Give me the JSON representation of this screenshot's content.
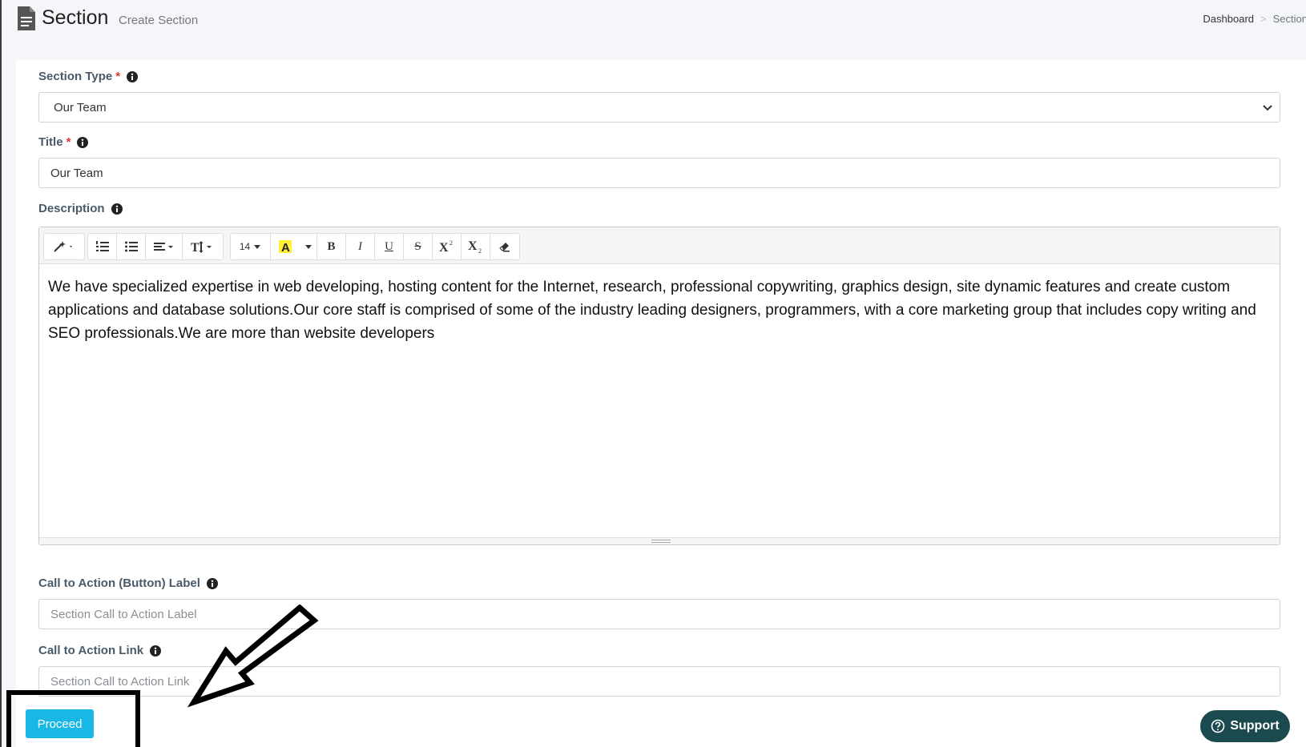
{
  "header": {
    "title": "Section",
    "subtitle": "Create Section",
    "breadcrumb": [
      {
        "label": "Dashboard"
      },
      {
        "label": "Section"
      }
    ],
    "breadcrumb_separator": ">"
  },
  "form": {
    "section_type": {
      "label": "Section Type",
      "required_mark": "*",
      "value": "Our Team"
    },
    "title": {
      "label": "Title",
      "required_mark": "*",
      "value": "Our Team"
    },
    "description": {
      "label": "Description",
      "toolbar": {
        "font_size": "14",
        "bold": "B",
        "italic": "I",
        "underline": "U",
        "strike": "S"
      },
      "content": "We have specialized expertise in web developing, hosting content for the Internet, research, professional copywriting, graphics design, site dynamic features and create custom applications and database solutions.Our core staff is comprised of some of the industry leading designers, programmers, with a core marketing group that includes copy writing and SEO professionals.We are more than website developers"
    },
    "cta_label": {
      "label": "Call to Action (Button) Label",
      "placeholder": "Section Call to Action Label"
    },
    "cta_link": {
      "label": "Call to Action Link",
      "placeholder": "Section Call to Action Link"
    },
    "proceed_label": "Proceed"
  },
  "support": {
    "label": "Support"
  },
  "colors": {
    "primary_button": "#17b8e6",
    "support_button": "#1b4a4e",
    "label_text": "#495a6b",
    "required": "#e4342e"
  }
}
